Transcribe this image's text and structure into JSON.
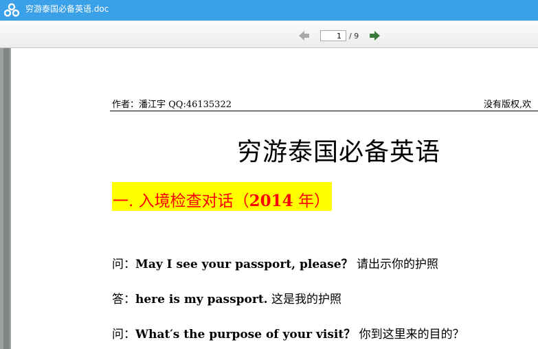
{
  "window": {
    "title": "穷游泰国必备英语.doc"
  },
  "toolbar": {
    "current_page": "1",
    "total_pages": "/ 9",
    "prev_icon": "left-arrow-icon",
    "next_icon": "right-arrow-icon"
  },
  "document": {
    "header_author": "作者：潘江宇    QQ:46135322",
    "header_rights": "没有版权,欢",
    "title": "穷游泰国必备英语",
    "section": {
      "prefix": "一. 入境检查对话（",
      "year": "2014",
      "suffix": " 年）"
    },
    "qa": [
      {
        "speaker": "问：",
        "english": "May I see your passport, please？",
        "chinese": " 请出示你的护照"
      },
      {
        "speaker": "答：",
        "english": "here is my passport.",
        "chinese": " 这是我的护照"
      },
      {
        "speaker": "问：",
        "english": "What′s the purpose of your visit？",
        "chinese": " 你到这里来的目的？"
      }
    ]
  },
  "colors": {
    "titlebar": "#3aa0e8",
    "highlight": "#ffff00",
    "section_text": "#ff0000"
  }
}
